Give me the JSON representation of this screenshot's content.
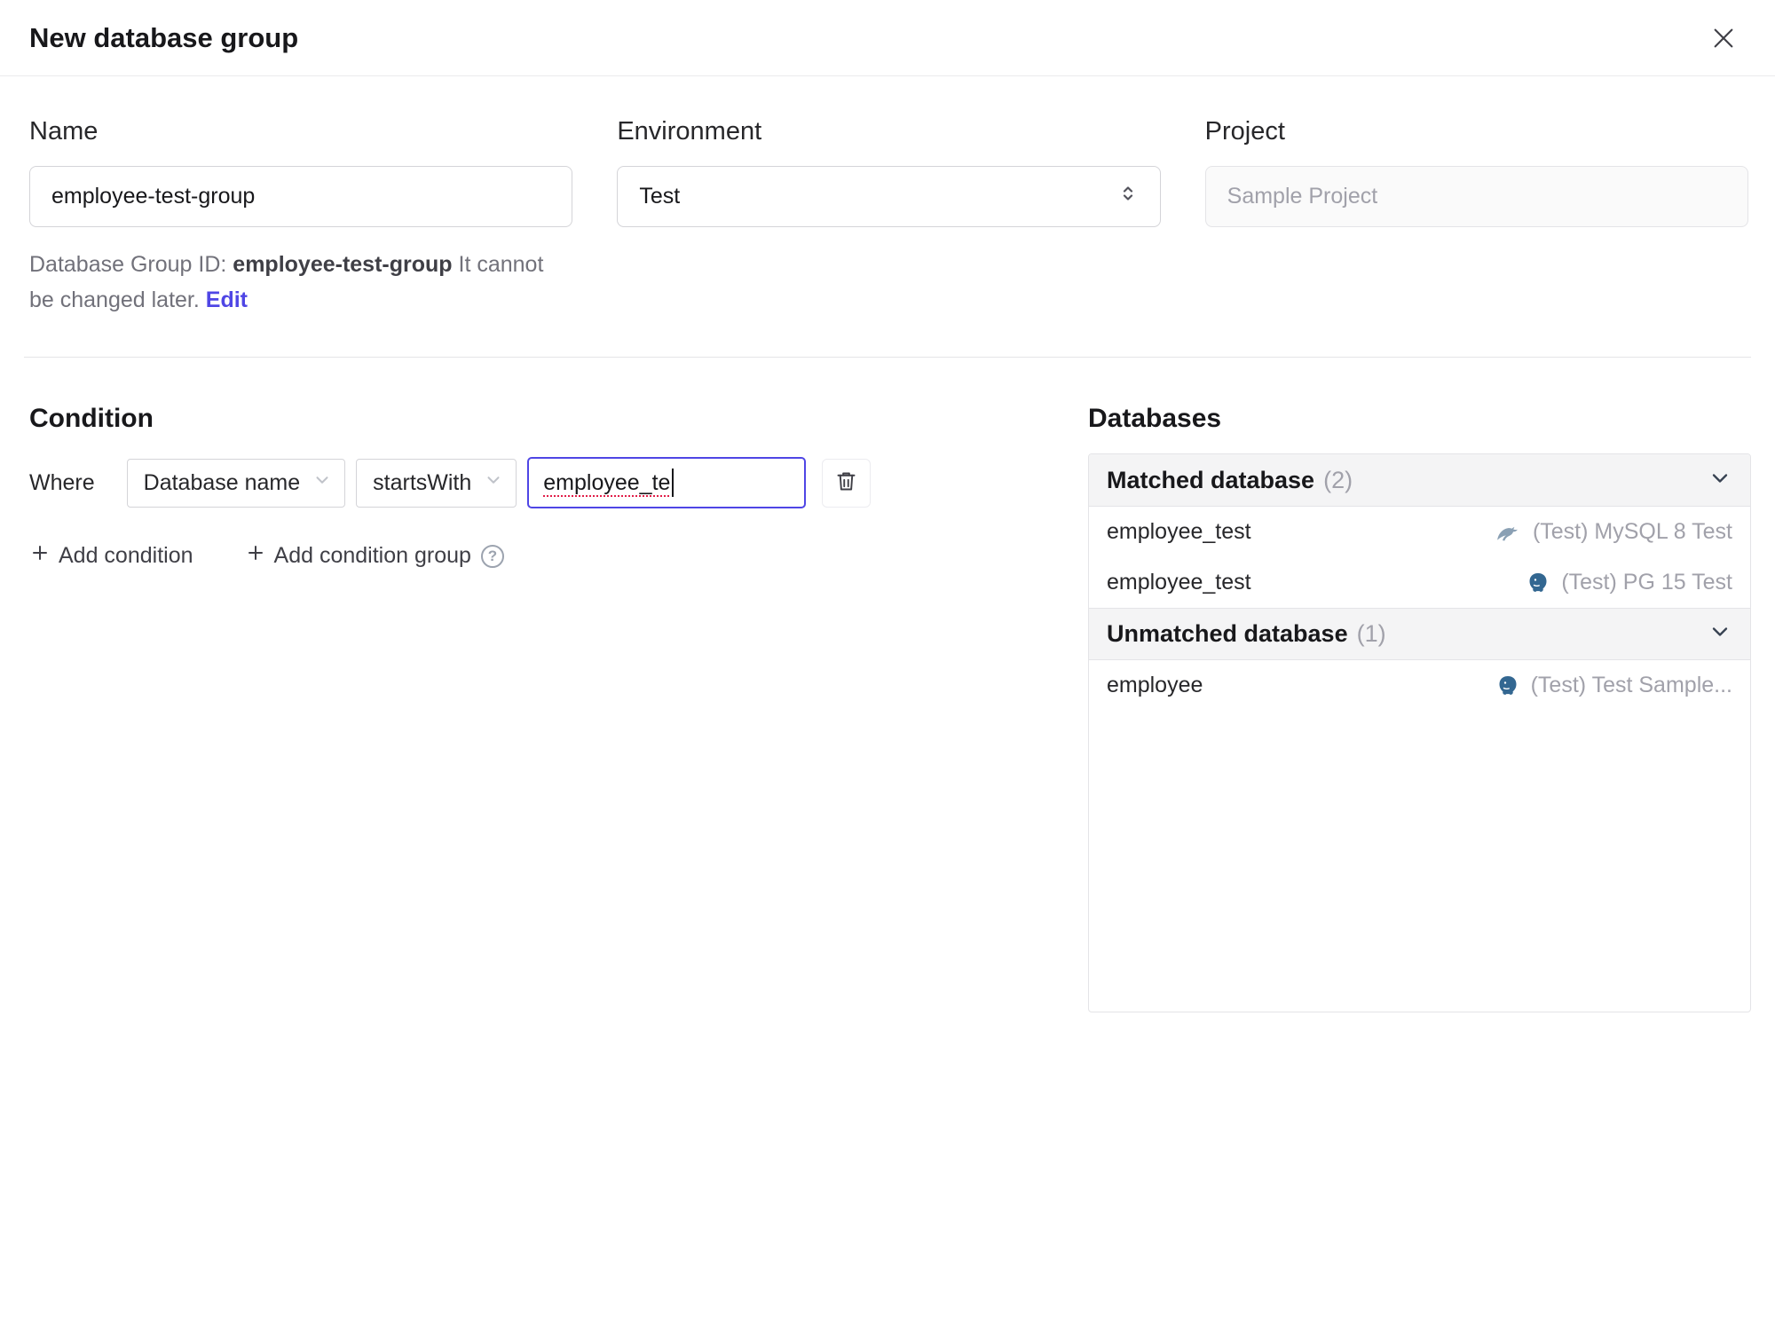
{
  "dialog": {
    "title": "New database group"
  },
  "form": {
    "name": {
      "label": "Name",
      "value": "employee-test-group",
      "helper_prefix": "Database Group ID: ",
      "helper_id": "employee-test-group",
      "helper_suffix": " It cannot be changed later. ",
      "edit_link": "Edit"
    },
    "environment": {
      "label": "Environment",
      "value": "Test"
    },
    "project": {
      "label": "Project",
      "value": "Sample Project"
    }
  },
  "condition": {
    "heading": "Condition",
    "where_label": "Where",
    "factor": "Database name",
    "operator": "startsWith",
    "value": "employee_te",
    "add_condition": "Add condition",
    "add_condition_group": "Add condition group",
    "help_glyph": "?"
  },
  "databases": {
    "heading": "Databases",
    "matched_label": "Matched database",
    "matched_count": "(2)",
    "matched_rows": [
      {
        "name": "employee_test",
        "engine": "mysql",
        "instance": "(Test) MySQL 8 Test"
      },
      {
        "name": "employee_test",
        "engine": "postgres",
        "instance": "(Test) PG 15 Test"
      }
    ],
    "unmatched_label": "Unmatched database",
    "unmatched_count": "(1)",
    "unmatched_rows": [
      {
        "name": "employee",
        "engine": "postgres",
        "instance": "(Test) Test Sample..."
      }
    ]
  },
  "colors": {
    "accent": "#4f46e5",
    "mysql_icon": "#8aa0b4",
    "postgres_icon": "#336791",
    "spellcheck": "#e11d48"
  }
}
